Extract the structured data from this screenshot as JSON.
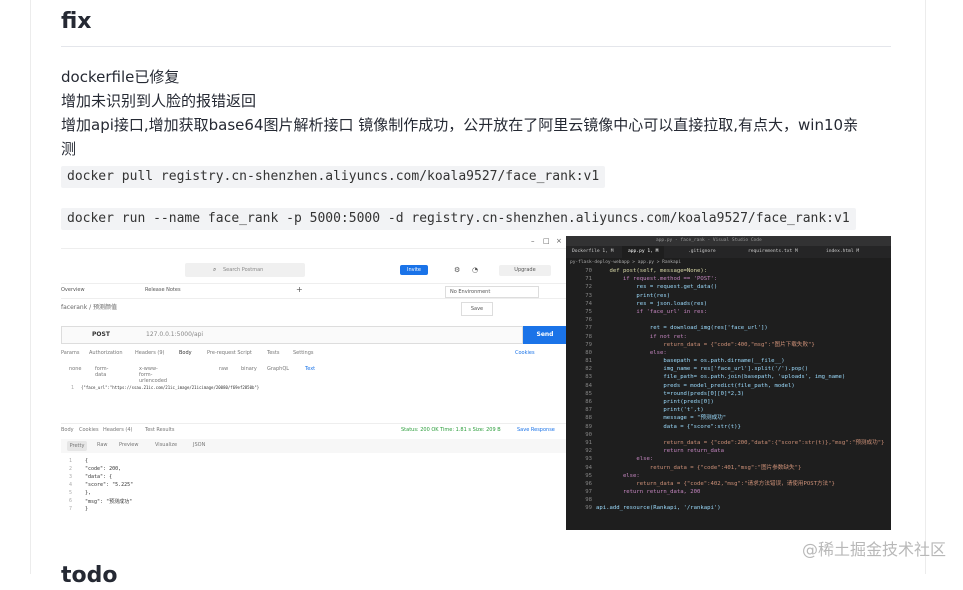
{
  "section": {
    "title": "fix"
  },
  "paragraph": {
    "line1": "dockerfile已修复",
    "line2": "增加未识别到人脸的报错返回",
    "line3": "增加api接口,增加获取base64图片解析接口 镜像制作成功，公开放在了阿里云镜像中心可以直接拉取,有点大，win10亲",
    "line4": "测"
  },
  "commands": {
    "pull": "docker pull registry.cn-shenzhen.aliyuncs.com/koala9527/face_rank:v1",
    "run": "docker run --name face_rank -p 5000:5000 -d registry.cn-shenzhen.aliyuncs.com/koala9527/face_rank:v1"
  },
  "postman": {
    "search_placeholder": "Search Postman",
    "invite_label": "Invite",
    "upgrade_label": "Upgrade",
    "overview_tab": "Overview",
    "release_tab": "Release Notes",
    "env_select": "No Environment",
    "breadcrumb": "facerank / 预测颜值",
    "save_label": "Save",
    "method": "POST",
    "url": "127.0.0.1:5000/api",
    "send_label": "Send",
    "request_tabs": [
      "Params",
      "Authorization",
      "Headers (9)",
      "Body",
      "Pre-request Script",
      "Tests",
      "Settings"
    ],
    "cookies_label": "Cookies",
    "body_options": [
      "none",
      "form-data",
      "x-www-form-urlencoded",
      "raw",
      "binary",
      "GraphQL",
      "Text"
    ],
    "request_body": "{\"face_url\":\"https://ssau.21ic.com/21ic_image/21icimage/20080/f69ef2850b\"}",
    "response_tabs": [
      "Body",
      "Cookies",
      "Headers (4)",
      "Test Results"
    ],
    "status": "Status: 200 OK   Time: 1.81 s   Size: 209 B",
    "save_response": "Save Response",
    "view_modes": [
      "Pretty",
      "Raw",
      "Preview",
      "Visualize",
      "JSON"
    ],
    "response_lines": [
      "{",
      "    \"code\": 200,",
      "    \"data\": {",
      "        \"score\": \"5.225\"",
      "    },",
      "    \"msg\": \"预测成功\"",
      "}"
    ]
  },
  "vscode": {
    "window_title": "app.py - face_rank - Visual Studio Code",
    "tabs": [
      "Dockerfile 1, M",
      "app.py 1, M",
      ".gitignore",
      "requirements.txt M",
      "index.html M"
    ],
    "breadcrumbs": "py-flask-deploy-webapp > app.py > Rankapi",
    "first_line_number": 70,
    "code_lines": [
      "    def post(self, message=None):",
      "        if request.method == 'POST':",
      "            res = request.get_data()",
      "            print(res)",
      "            res = json.loads(res)",
      "            if 'face_url' in res:",
      "",
      "                ret = download_img(res['face_url'])",
      "                if not ret:",
      "                    return_data = {\"code\":400,\"msg\":\"图片下载失败\"}",
      "                else:",
      "                    basepath = os.path.dirname(__file__)",
      "                    img_name = res['face_url'].split('/').pop()",
      "                    file_path= os.path.join(basepath, 'uploads', img_name)",
      "                    preds = model_predict(file_path, model)",
      "                    t=round(preds[0][0]*2,3)",
      "                    print(preds[0])",
      "                    print('t',t)",
      "                    message = \"预测成功\"",
      "                    data = {\"score\":str(t)}",
      "",
      "                    return_data = {\"code\":200,\"data\":{\"score\":str(t)},\"msg\":\"预测成功\"}",
      "                    return return_data",
      "            else:",
      "                return_data = {\"code\":401,\"msg\":\"图片参数缺失\"}",
      "        else:",
      "            return_data = {\"code\":402,\"msg\":\"请求方法错误，请使用POST方法\"}",
      "        return return_data, 200",
      "",
      "api.add_resource(Rankapi, '/rankapi')"
    ]
  },
  "watermark": "@稀土掘金技术社区",
  "next_heading": "todo"
}
